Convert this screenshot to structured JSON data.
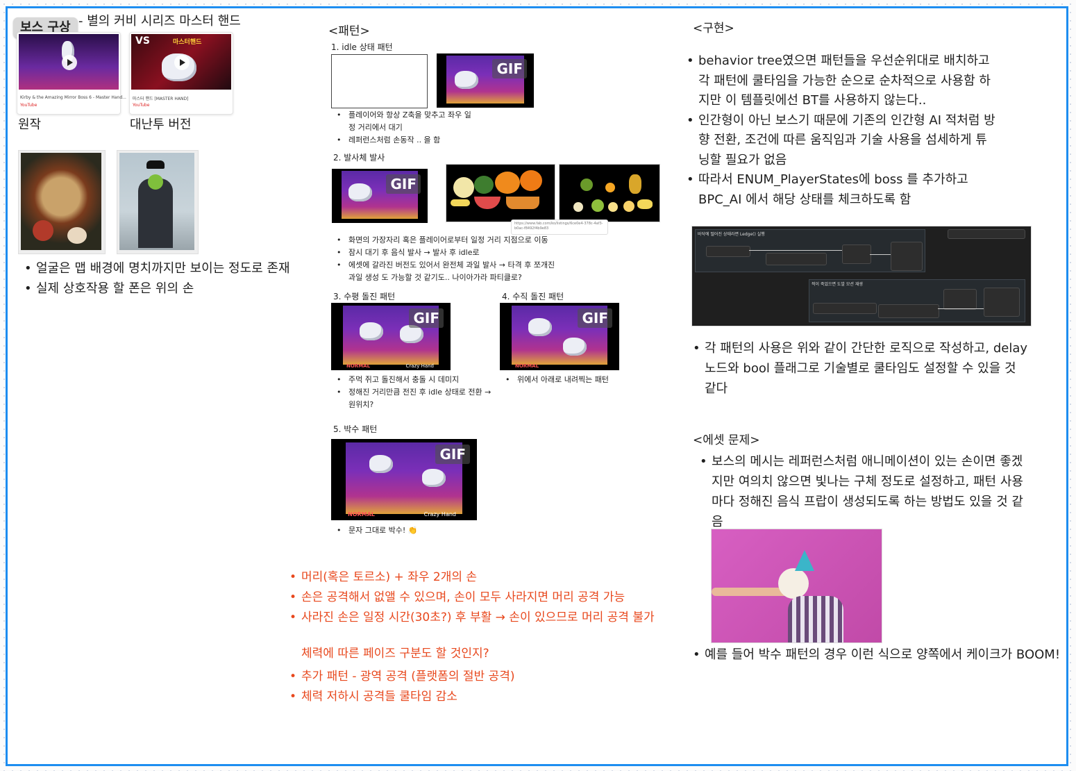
{
  "board": {
    "badge": "보스 구상",
    "title_suffix": "- 별의 커비 시리즈 마스터 핸드",
    "video_original": {
      "caption": "Kirby & the Amazing Mirror Boss 6 - Master Hand...",
      "source": "YouTube"
    },
    "video_dairantou": {
      "caption": "마스터 핸드 [MASTER HAND]",
      "source": "YouTube",
      "banner": "마스터핸드",
      "vs": "VS"
    },
    "label_original": "원작",
    "label_dairantou": "대난투 버전",
    "face_bullets": [
      "얼굴은 맵 배경에 명치까지만 보이는 정도로 존재",
      "실제 상호작용 할 폰은 위의 손"
    ]
  },
  "pattern": {
    "heading": "<패턴>",
    "gif_label": "GIF",
    "p1": {
      "title": "1. idle 상태 패턴",
      "bullets": [
        "플레이어와 항상 Z축을 맞추고 좌우 일정 거리에서 대기",
        "레퍼런스처럼 손동작 .. 을 함"
      ]
    },
    "p2": {
      "title": "2. 발사체 발사",
      "bullets": [
        "화면의 가장자리 혹은 플레이어로부터 일정 거리 지점으로 이동",
        "잠시 대기 후 음식 발사 → 발사 후 idle로",
        "에셋에 갈라진 버전도 있어서 완전체 과일 발사 → 타격 후 쪼개진 과일 생성 도 가능할 것 같기도.. 나이아가라 파티클로?"
      ],
      "link": "https://www.fab.com/ko/listings/6ce0e4-378c-4af3-b0ac-f8492f4b9e83"
    },
    "p3": {
      "title": "3. 수평 돌진 패턴",
      "bullets": [
        "주먹 쥐고 돌진해서 충돌 시 데미지",
        "정해진 거리만큼 전진 후 idle 상태로 전환 → 원위치?"
      ]
    },
    "p4": {
      "title": "4. 수직 돌진 패턴",
      "bullets": [
        "위에서 아래로 내려찍는 패턴"
      ]
    },
    "p5": {
      "title": "5. 박수 패턴",
      "bullets": [
        "문자 그대로 박수! 👏"
      ]
    },
    "game_hud": {
      "normal": "NORMAL",
      "boss": "Crazy Hand"
    }
  },
  "notes_red": [
    "머리(혹은 토르소) + 좌우 2개의 손",
    "손은 공격해서 없앨 수 있으며, 손이 모두 사라지면 머리 공격 가능",
    "사라진 손은 일정 시간(30초?) 후 부활 → 손이 있으므로 머리 공격 불가"
  ],
  "notes_red_plain": "체력에 따른 페이즈 구분도 할 것인지?",
  "notes_red_more": [
    "추가 패턴 - 광역 공격 (플랫폼의 절반 공격)",
    "체력 저하시 공격들 쿨타임 감소"
  ],
  "impl": {
    "heading": "<구현>",
    "bullets": [
      "behavior tree였으면 패턴들을 우선순위대로 배치하고 각 패턴에 쿨타임을 가능한 순으로 순차적으로 사용함 하지만 이 템플릿에선 BT를 사용하지 않는다..",
      "인간형이 아닌 보스기 때문에 기존의 인간형 AI 적처럼 방향 전환, 조건에 따른 움직임과 기술 사용을 섬세하게 튜닝할 필요가 없음",
      "따라서 ENUM_PlayerStates에 boss 를 추가하고 BPC_AI 에서 해당 상태를 체크하도록 함"
    ],
    "bp_comment1": "바닥에 떨어진 상태라면 Ledge() 실행",
    "bp_comment2": "적이 죽었으면 도발 모션 재생",
    "after_bullets": [
      "각 패턴의 사용은 위와 같이 간단한 로직으로 작성하고, delay 노드와 bool 플래그로 기술별로 쿨타임도 설정할 수 있을 것 같다"
    ]
  },
  "asset": {
    "heading": "<에셋 문제>",
    "bullets": [
      "보스의 메시는 레퍼런스처럼 애니메이션이 있는 손이면 좋겠지만 여의치 않으면 빛나는 구체 정도로 설정하고, 패턴 사용마다 정해진 음식 프랍이 생성되도록 하는 방법도 있을 것 같음"
    ],
    "after_bullets": [
      "예를 들어 박수 패턴의 경우 이런 식으로 양쪽에서 케이크가 BOOM!"
    ]
  },
  "colors": {
    "frame": "#1d8df0",
    "red_note": "#e8481d"
  }
}
